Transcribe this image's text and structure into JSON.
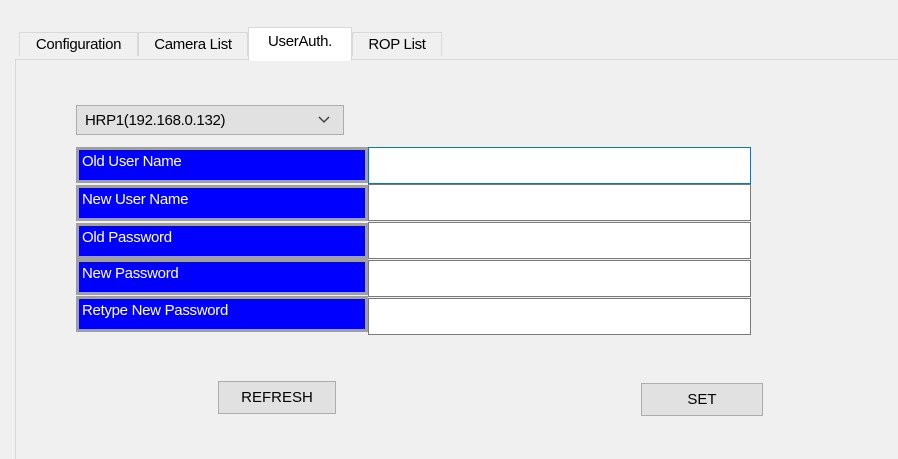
{
  "tabs": [
    {
      "label": "Configuration"
    },
    {
      "label": "Camera List"
    },
    {
      "label": "UserAuth."
    },
    {
      "label": "ROP List"
    }
  ],
  "active_tab": "UserAuth.",
  "device_select": {
    "value": "HRP1(192.168.0.132)",
    "icon": "chevron-down-icon"
  },
  "fields": [
    {
      "label": "Old User Name",
      "value": ""
    },
    {
      "label": "New User Name",
      "value": ""
    },
    {
      "label": "Old Password",
      "value": ""
    },
    {
      "label": "New Password",
      "value": ""
    },
    {
      "label": "Retype New Password",
      "value": ""
    }
  ],
  "buttons": {
    "refresh": "REFRESH",
    "set": "SET"
  },
  "colors": {
    "label_bg": "#0000ff",
    "label_text": "#ffffff",
    "focus_border": "#0078d7"
  }
}
